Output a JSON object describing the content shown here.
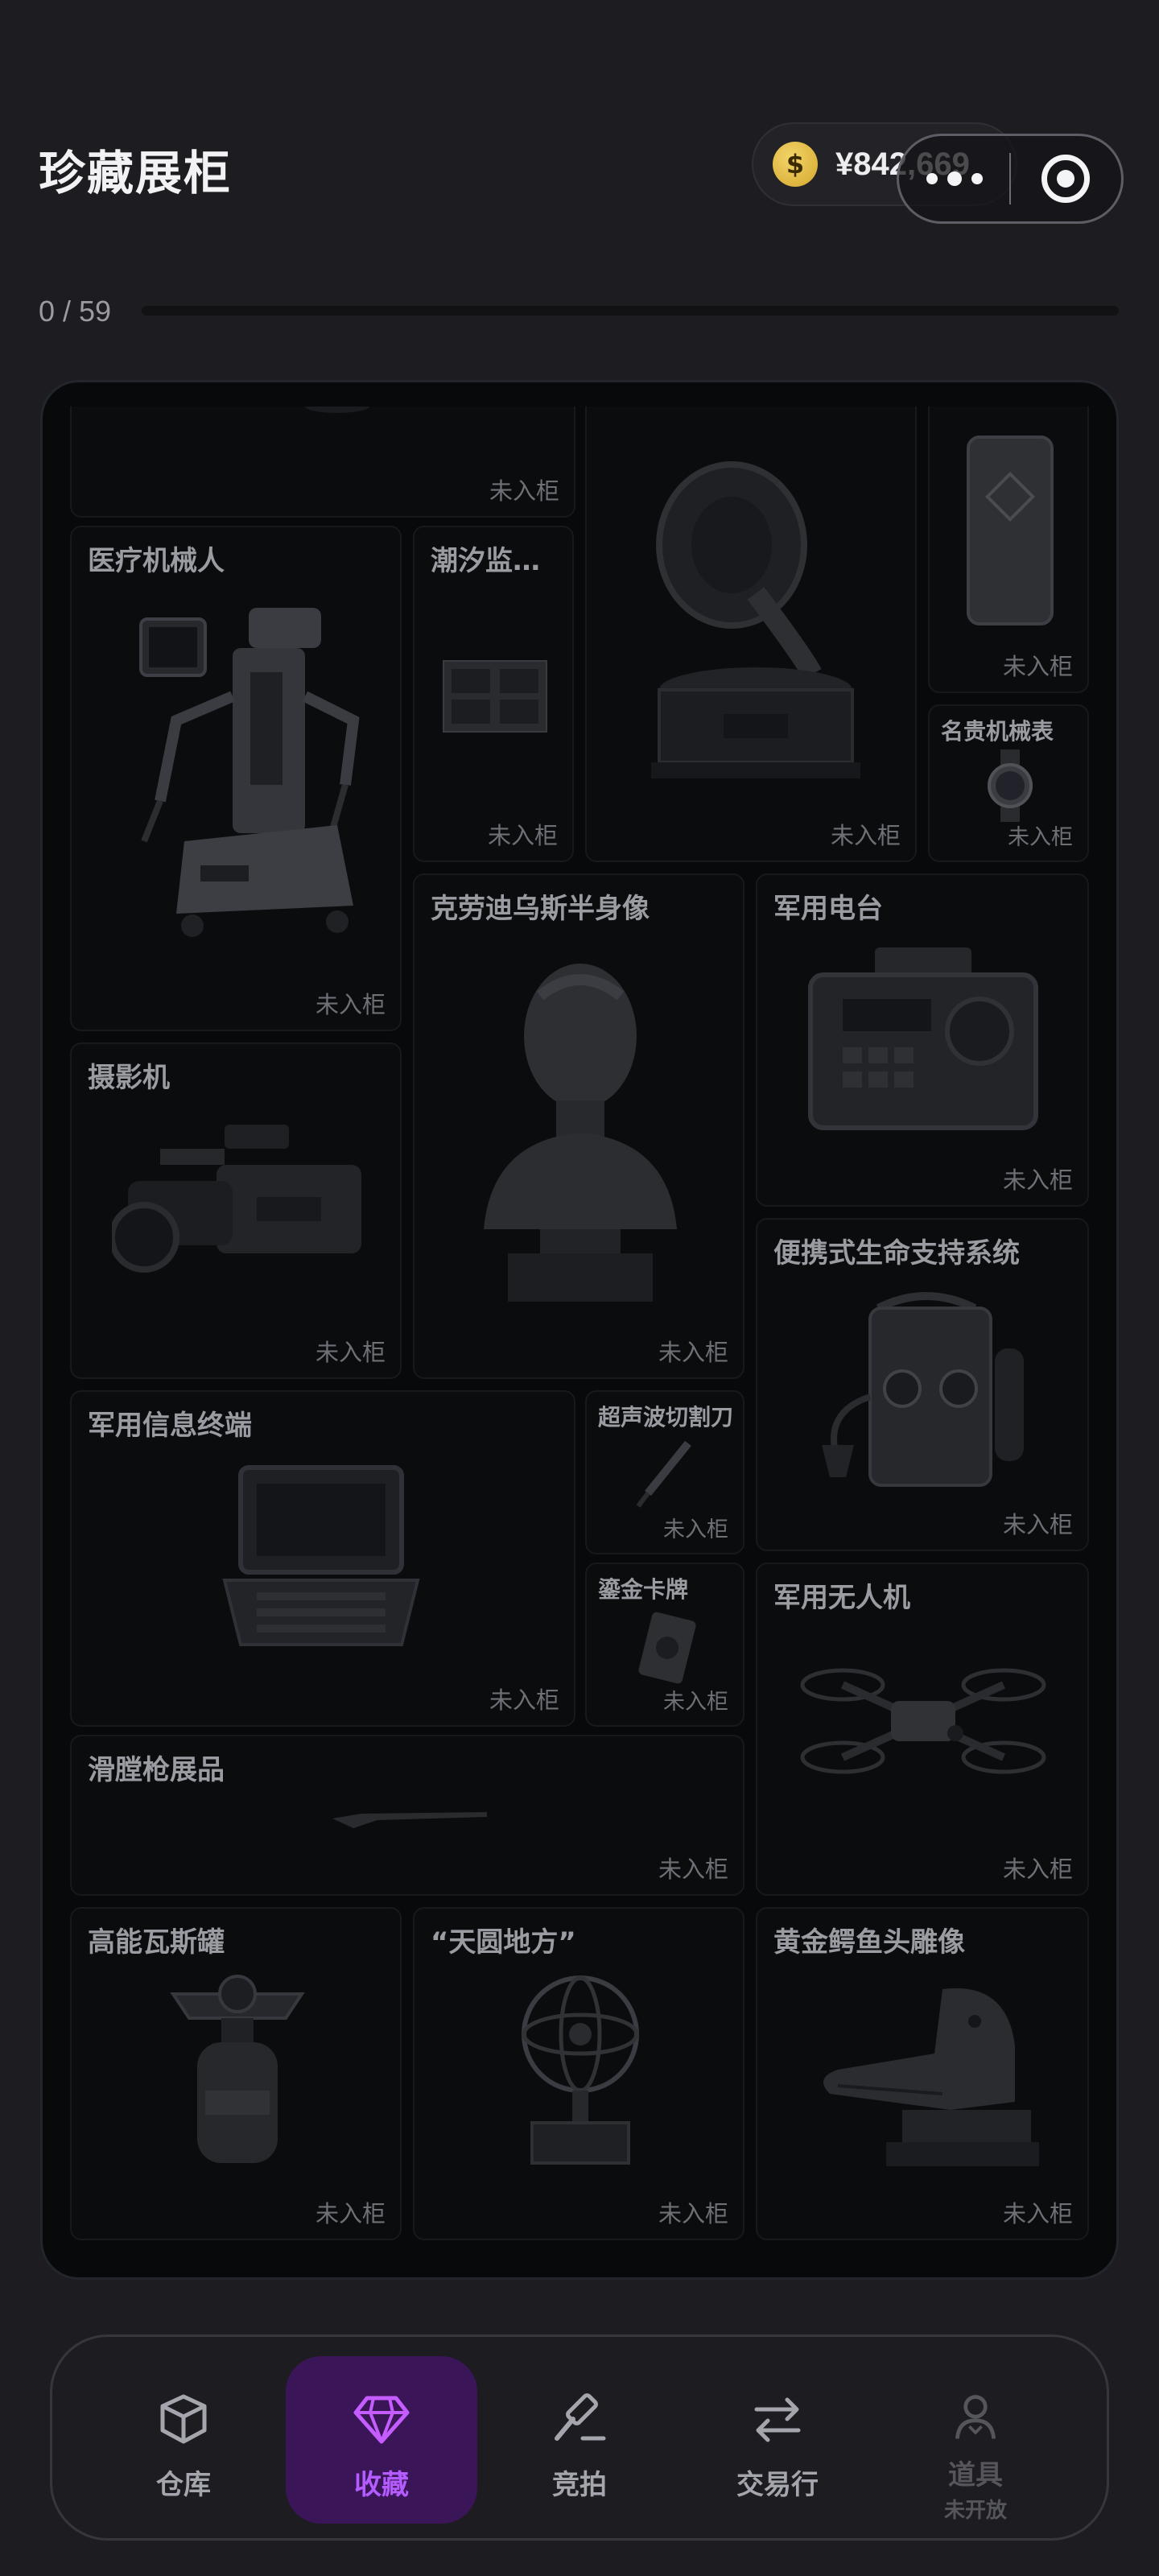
{
  "header": {
    "title": "珍藏展柜",
    "balance": "¥842,669",
    "coin_symbol": "$"
  },
  "progress": {
    "label": "0 / 59",
    "collected": 0,
    "total": 59,
    "accent": "#8b5cf6"
  },
  "cabinet": {
    "status_text": "未入柜",
    "items": [
      {
        "name": "",
        "icon": "unknown-item-icon"
      },
      {
        "name": "医疗机械人",
        "icon": "medical-robot-icon"
      },
      {
        "name": "潮汐监…",
        "icon": "tide-monitor-icon"
      },
      {
        "name": "",
        "icon": "gramophone-icon"
      },
      {
        "name": "",
        "icon": "silver-bar-icon"
      },
      {
        "name": "名贵机械表",
        "icon": "watch-icon"
      },
      {
        "name": "克劳迪乌斯半身像",
        "icon": "bust-icon"
      },
      {
        "name": "军用电台",
        "icon": "radio-icon"
      },
      {
        "name": "摄影机",
        "icon": "video-camera-icon"
      },
      {
        "name": "便携式生命支持系统",
        "icon": "life-support-icon"
      },
      {
        "name": "军用信息终端",
        "icon": "rugged-laptop-icon"
      },
      {
        "name": "超声波切割刀",
        "icon": "ultrasonic-knife-icon"
      },
      {
        "name": "鎏金卡牌",
        "icon": "gold-card-icon"
      },
      {
        "name": "军用无人机",
        "icon": "drone-icon"
      },
      {
        "name": "滑膛枪展品",
        "icon": "musket-icon"
      },
      {
        "name": "高能瓦斯罐",
        "icon": "gas-canister-icon"
      },
      {
        "name": "“天圆地方”",
        "icon": "armillary-sphere-icon"
      },
      {
        "name": "黄金鳄鱼头雕像",
        "icon": "crocodile-head-icon"
      }
    ]
  },
  "tabbar": {
    "tabs": [
      {
        "label": "仓库",
        "icon": "box-icon"
      },
      {
        "label": "收藏",
        "icon": "diamond-icon",
        "active": true
      },
      {
        "label": "竞拍",
        "icon": "gavel-icon"
      },
      {
        "label": "交易行",
        "icon": "swap-arrows-icon"
      },
      {
        "label": "道具",
        "sub": "未开放",
        "icon": "person-icon",
        "disabled": true
      }
    ],
    "active_color": "#b45cff"
  }
}
